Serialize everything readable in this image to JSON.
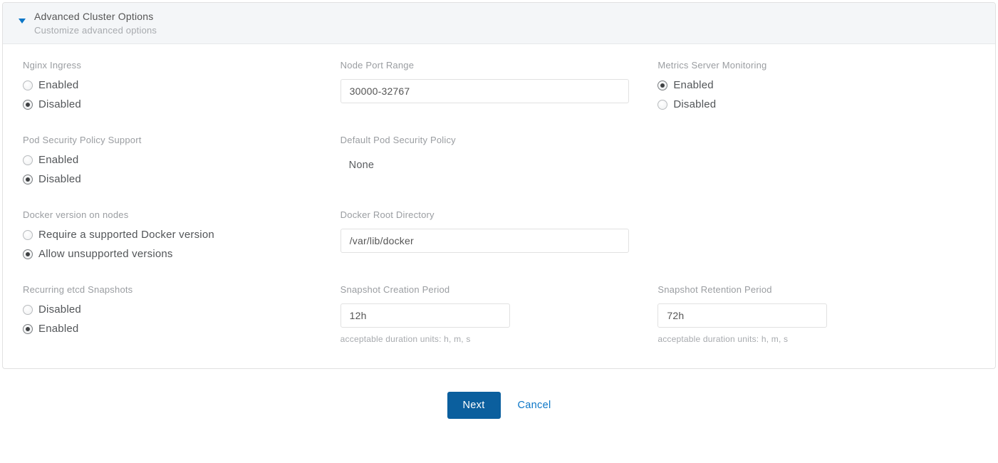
{
  "panel": {
    "title": "Advanced Cluster Options",
    "subtitle": "Customize advanced options"
  },
  "fields": {
    "nginx_ingress": {
      "label": "Nginx Ingress",
      "options": {
        "enabled": "Enabled",
        "disabled": "Disabled"
      },
      "selected": "disabled"
    },
    "node_port_range": {
      "label": "Node Port Range",
      "value": "30000-32767"
    },
    "metrics_server": {
      "label": "Metrics Server Monitoring",
      "options": {
        "enabled": "Enabled",
        "disabled": "Disabled"
      },
      "selected": "enabled"
    },
    "psp_support": {
      "label": "Pod Security Policy Support",
      "options": {
        "enabled": "Enabled",
        "disabled": "Disabled"
      },
      "selected": "disabled"
    },
    "default_psp": {
      "label": "Default Pod Security Policy",
      "value": "None"
    },
    "docker_version": {
      "label": "Docker version on nodes",
      "options": {
        "require": "Require a supported Docker version",
        "allow": "Allow unsupported versions"
      },
      "selected": "allow"
    },
    "docker_root": {
      "label": "Docker Root Directory",
      "value": "/var/lib/docker"
    },
    "etcd_snapshots": {
      "label": "Recurring etcd Snapshots",
      "options": {
        "disabled": "Disabled",
        "enabled": "Enabled"
      },
      "selected": "enabled"
    },
    "snapshot_creation": {
      "label": "Snapshot Creation Period",
      "value": "12h",
      "helper": "acceptable duration units: h, m, s"
    },
    "snapshot_retention": {
      "label": "Snapshot Retention Period",
      "value": "72h",
      "helper": "acceptable duration units: h, m, s"
    }
  },
  "actions": {
    "next": "Next",
    "cancel": "Cancel"
  }
}
